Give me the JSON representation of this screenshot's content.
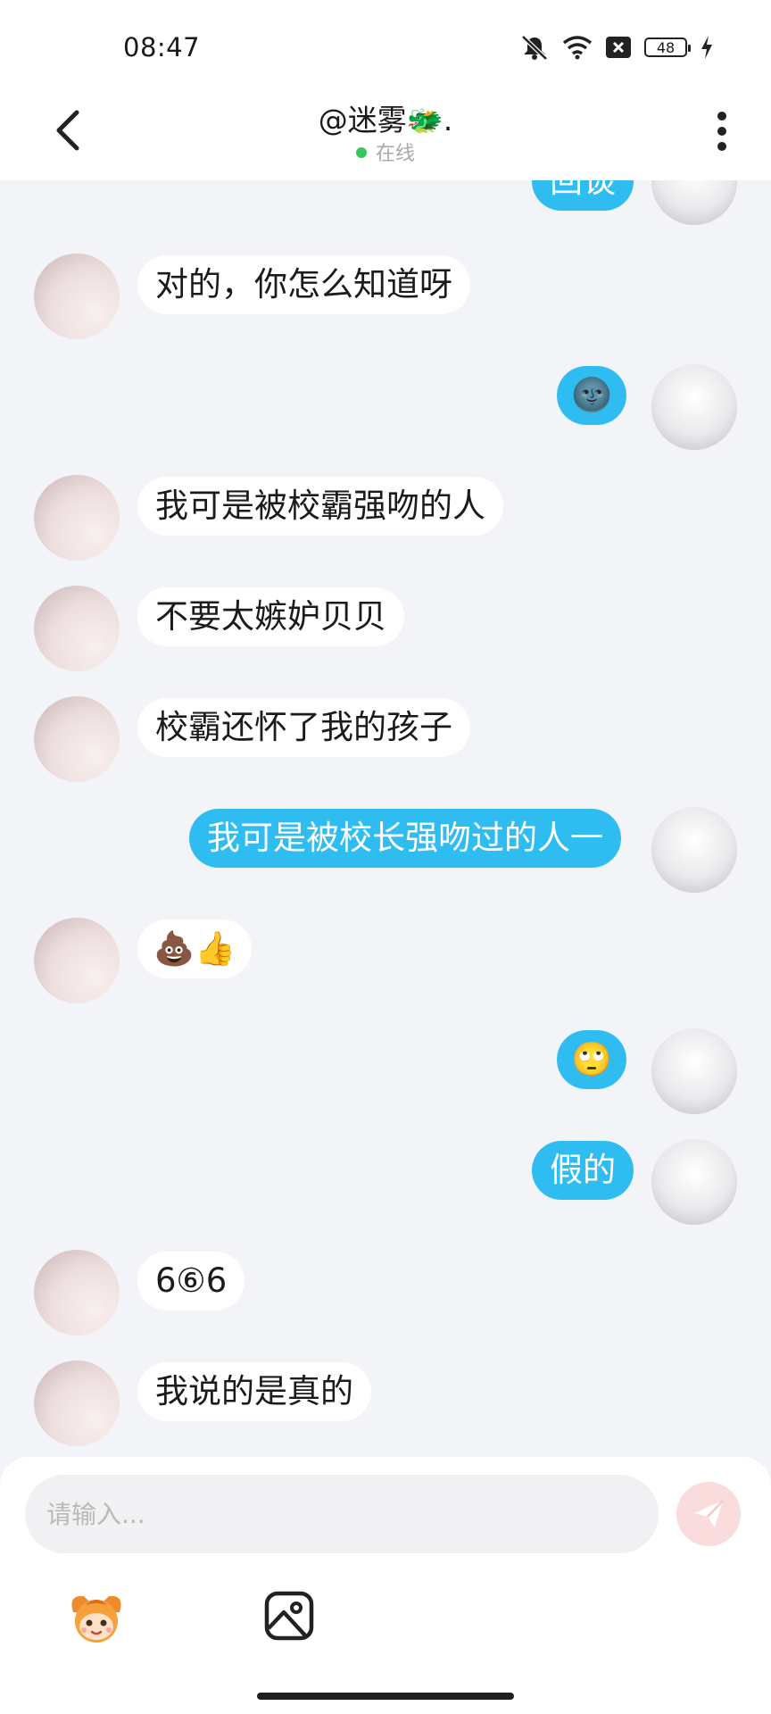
{
  "status_bar": {
    "time": "08:47",
    "battery": "48"
  },
  "header": {
    "title": "@迷雾🐲.",
    "status": "在线"
  },
  "messages": [
    {
      "side": "out",
      "text": "回谈",
      "partial": true
    },
    {
      "side": "in",
      "text": "对的，你怎么知道呀"
    },
    {
      "side": "out",
      "text": "🌚"
    },
    {
      "side": "in",
      "text": "我可是被校霸强吻的人"
    },
    {
      "side": "in",
      "text": "不要太嫉妒贝贝"
    },
    {
      "side": "in",
      "text": "校霸还怀了我的孩子"
    },
    {
      "side": "out",
      "text": "我可是被校长强吻过的人一"
    },
    {
      "side": "in",
      "text": "💩👍"
    },
    {
      "side": "out",
      "text": "🙄"
    },
    {
      "side": "out",
      "text": "假的"
    },
    {
      "side": "in",
      "text": "6⑥6"
    },
    {
      "side": "in",
      "text": "我说的是真的"
    }
  ],
  "composer": {
    "placeholder": "请输入..."
  },
  "colors": {
    "outgoing_bubble": "#2fbdf1",
    "incoming_bubble": "#ffffff",
    "background": "#f3f4f8",
    "online_dot": "#35c759",
    "send_button": "#fbdcdc"
  },
  "icons": [
    "back-arrow-icon",
    "more-vertical-icon",
    "send-icon",
    "emoji-mascot-icon",
    "image-icon",
    "mute-icon",
    "wifi-icon",
    "sim-x-icon",
    "battery-icon",
    "charging-icon"
  ]
}
